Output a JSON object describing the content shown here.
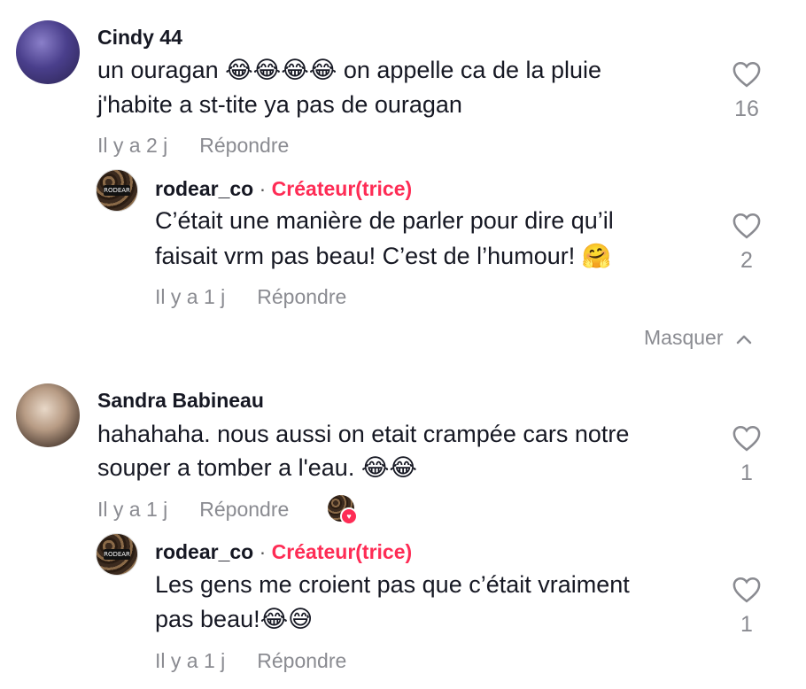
{
  "comments": [
    {
      "username": "Cindy 44",
      "line1": "un ouragan 😂😂😂😂 on appelle ca de la pluie",
      "line2": "j'habite a st-tite ya pas de ouragan",
      "time": "Il y a 2 j",
      "reply_label": "Répondre",
      "likes": "16",
      "avatar": "christmas-tree-photo",
      "reply": {
        "username": "rodear_co",
        "separator": "·",
        "badge": "Créateur(trice)",
        "line1": "C’était une manière de parler pour dire qu’il",
        "line2": "faisait vrm pas beau! C’est de l’humour! 🤗",
        "time": "Il y a 1 j",
        "reply_label": "Répondre",
        "likes": "2",
        "avatar_logo": "RODEAR"
      }
    },
    {
      "username": "Sandra Babineau",
      "line1": "hahahaha. nous aussi on etait crampée cars notre",
      "line2": "souper a tomber a l'eau. 😂😂",
      "time": "Il y a 1 j",
      "reply_label": "Répondre",
      "likes": "1",
      "avatar": "person-photo",
      "reply": {
        "username": "rodear_co",
        "separator": "·",
        "badge": "Créateur(trice)",
        "line1": "Les gens me croient pas que c’était vraiment",
        "line2": "pas beau!😂😅",
        "time": "Il y a 1 j",
        "reply_label": "Répondre",
        "likes": "1",
        "avatar_logo": "RODEAR"
      }
    }
  ],
  "hide_replies_label": "Masquer",
  "colors": {
    "creator": "#fe2c55",
    "muted": "#8a8b91",
    "text": "#161823"
  }
}
